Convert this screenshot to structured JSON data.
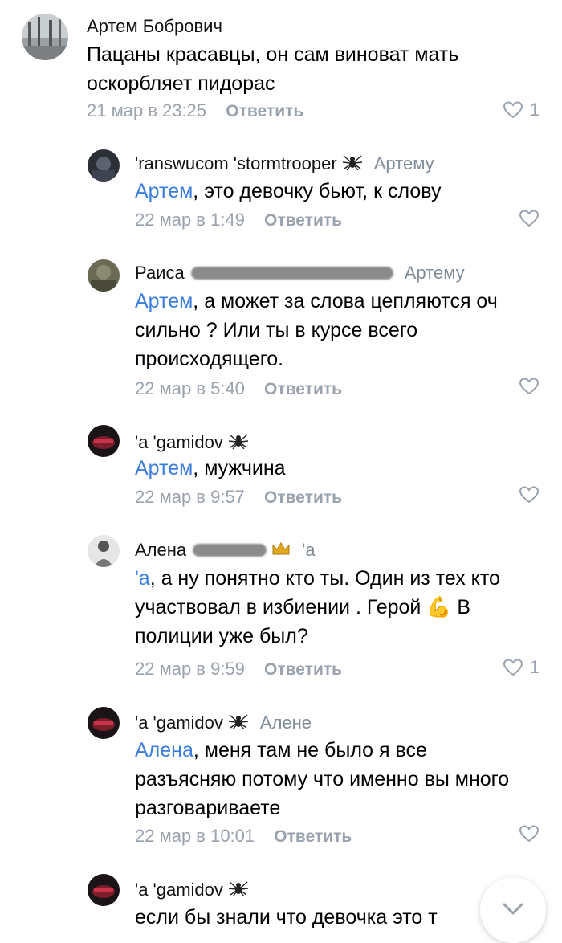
{
  "comments": [
    {
      "name": "Артем Бобрович",
      "text": "Пацаны красавцы, он сам виноват мать оскорбляет пидорас",
      "date": "21 мар в 23:25",
      "reply": "Ответить",
      "likes": "1"
    },
    {
      "name": "'ranswucom 'stormtrooper",
      "reply_to": "Артему",
      "mention": "Артем",
      "text": ", это девочку бьют, к слову",
      "date": "22 мар в 1:49",
      "reply": "Ответить"
    },
    {
      "name": "Раиса",
      "reply_to": "Артему",
      "mention": "Артем",
      "text": ", а может за слова цепляются оч сильно ? Или ты в курсе всего происходящего.",
      "date": "22 мар в 5:40",
      "reply": "Ответить"
    },
    {
      "name": "'a 'gamidov",
      "mention": "Артем",
      "text": ", мужчина",
      "date": "22 мар в 9:57",
      "reply": "Ответить"
    },
    {
      "name": "Алена",
      "reply_to": "'a",
      "mention": "'a",
      "text": ", а ну понятно кто ты. Один из тех кто участвовал в избиении . Герой 💪 В полиции уже был?",
      "date": "22 мар в 9:59",
      "reply": "Ответить",
      "likes": "1"
    },
    {
      "name": "'a 'gamidov",
      "reply_to": "Алене",
      "mention": "Алена",
      "text": ", меня там не было я все разъясняю потому что именно вы много разговариваете",
      "date": "22 мар в 10:01",
      "reply": "Ответить"
    },
    {
      "name": "'a 'gamidov",
      "text": "если бы знали что девочка это т"
    }
  ],
  "icons": {
    "like": "heart-outline-icon",
    "scroll": "chevron-down-icon",
    "spider": "spider-emoji",
    "crown": "crown-emoji"
  },
  "colors": {
    "mention": "#3b7ddd",
    "meta": "#99a2ad",
    "reply_to": "#818c99"
  }
}
